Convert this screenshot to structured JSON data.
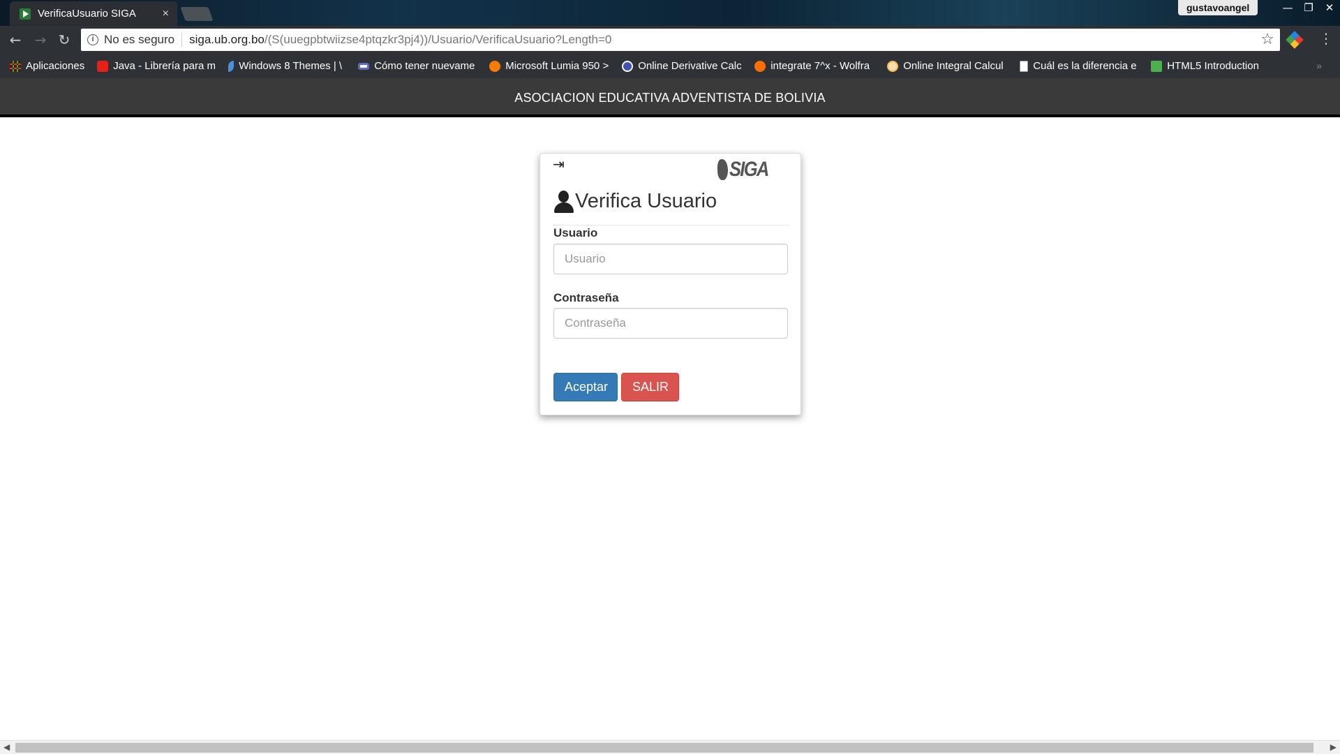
{
  "browser": {
    "tab_title": "VerificaUsuario SIGA",
    "tab_close": "×",
    "profile_name": "gustavoangel",
    "window_controls": {
      "minimize": "—",
      "restore": "❐",
      "close": "✕"
    },
    "nav": {
      "back": "←",
      "forward": "→",
      "reload": "↻"
    },
    "address": {
      "info": "i",
      "security_text": "No es seguro",
      "host": "siga.ub.org.bo",
      "path": "/(S(uuegpbtwiizse4ptqzkr3pj4))/Usuario/VerificaUsuario?Length=0"
    },
    "star": "☆",
    "menu": "⋮",
    "bookmarks": [
      {
        "label": "Aplicaciones",
        "icon": "apps-grid-icon",
        "color": "#e53935"
      },
      {
        "label": "Java - Librería para m",
        "icon": "youtube-icon",
        "color": "#e62117"
      },
      {
        "label": "Windows 8 Themes | \\",
        "icon": "feather-icon",
        "color": "#4a90d9"
      },
      {
        "label": "Cómo tener nuevame",
        "icon": "link-icon",
        "color": "#5c6bc0"
      },
      {
        "label": "Microsoft Lumia 950 >",
        "icon": "blogger-icon",
        "color": "#f57c00"
      },
      {
        "label": "Online Derivative Calc",
        "icon": "calc-icon",
        "color": "#3f51b5"
      },
      {
        "label": "integrate 7^x - Wolfra",
        "icon": "wolfram-icon",
        "color": "#ff6f00"
      },
      {
        "label": "Online Integral Calcul",
        "icon": "integral-icon",
        "color": "#ffb74d"
      },
      {
        "label": "Cuál es la diferencia e",
        "icon": "page-icon",
        "color": "#bdbdbd"
      },
      {
        "label": "HTML5 Introduction",
        "icon": "w3-icon",
        "color": "#4caf50"
      }
    ],
    "bookmarks_more": "»"
  },
  "site": {
    "header": "ASOCIACION EDUCATIVA ADVENTISTA DE BOLIVIA"
  },
  "login": {
    "login_icon": "⇥",
    "logo_text": "SIGA",
    "title": "Verifica Usuario",
    "usuario_label": "Usuario",
    "usuario_placeholder": "Usuario",
    "password_label": "Contraseña",
    "password_placeholder": "Contraseña",
    "accept_button": "Aceptar",
    "exit_button": "SALIR"
  },
  "scrollbar": {
    "left": "◀",
    "right": "▶"
  }
}
